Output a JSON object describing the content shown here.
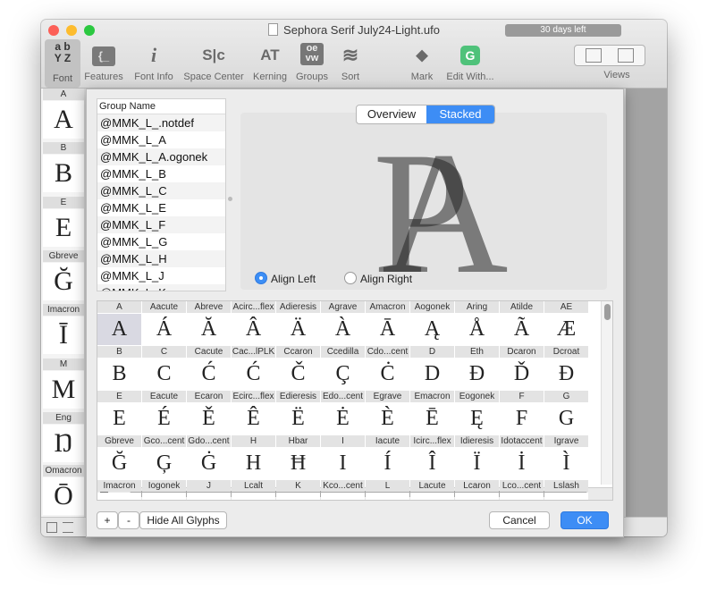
{
  "window": {
    "title": "Sephora Serif July24-Light.ufo",
    "trial_badge": "30 days left"
  },
  "toolbar": {
    "font_glyph": "a b\nY Z",
    "items": [
      {
        "label": "Font",
        "icon": "font-abyz-icon"
      },
      {
        "label": "Features",
        "icon": "features-icon",
        "glyph": "{_"
      },
      {
        "label": "Font Info",
        "icon": "font-info-icon",
        "glyph": "i"
      },
      {
        "label": "Space Center",
        "icon": "space-center-icon",
        "glyph": "S|c"
      },
      {
        "label": "Kerning",
        "icon": "kerning-icon",
        "glyph": "AT"
      },
      {
        "label": "Groups",
        "icon": "groups-icon",
        "glyph": "oe"
      },
      {
        "label": "Sort",
        "icon": "sort-icon",
        "glyph": "≋"
      },
      {
        "label": "Mark",
        "icon": "mark-icon",
        "glyph": "◆"
      },
      {
        "label": "Edit With...",
        "icon": "edit-with-icon",
        "glyph": "G"
      },
      {
        "label": "Views",
        "icon": "views-icon"
      }
    ]
  },
  "background_font": {
    "cells": [
      {
        "name": "A",
        "glyph": "A"
      },
      {
        "name": "B",
        "glyph": "B"
      },
      {
        "name": "E",
        "glyph": "E"
      },
      {
        "name": "Gbreve",
        "glyph": "Ğ"
      },
      {
        "name": "Imacron",
        "glyph": "Ī"
      },
      {
        "name": "M",
        "glyph": "M"
      },
      {
        "name": "Eng",
        "glyph": "Ŋ"
      },
      {
        "name": "Omacron",
        "glyph": "Ō"
      }
    ]
  },
  "groups": {
    "header": "Group Name",
    "items": [
      "@MMK_L_.notdef",
      "@MMK_L_A",
      "@MMK_L_A.ogonek",
      "@MMK_L_B",
      "@MMK_L_C",
      "@MMK_L_E",
      "@MMK_L_F",
      "@MMK_L_G",
      "@MMK_L_H",
      "@MMK_L_J",
      "@MMK_L_K"
    ]
  },
  "preview": {
    "tabs": [
      "Overview",
      "Stacked"
    ],
    "active_tab": "Stacked",
    "align_left": "Align Left",
    "align_right": "Align Right",
    "selected_align": "Align Left"
  },
  "glyph_grid": {
    "rows": [
      [
        [
          "A",
          "A"
        ],
        [
          "Aacute",
          "Á"
        ],
        [
          "Abreve",
          "Ă"
        ],
        [
          "Acirc...flex",
          "Â"
        ],
        [
          "Adieresis",
          "Ä"
        ],
        [
          "Agrave",
          "À"
        ],
        [
          "Amacron",
          "Ā"
        ],
        [
          "Aogonek",
          "Ą"
        ],
        [
          "Aring",
          "Å"
        ],
        [
          "Atilde",
          "Ã"
        ],
        [
          "AE",
          "Æ"
        ]
      ],
      [
        [
          "B",
          "B"
        ],
        [
          "C",
          "C"
        ],
        [
          "Cacute",
          "Ć"
        ],
        [
          "Cac...lPLK",
          "Ć"
        ],
        [
          "Ccaron",
          "Č"
        ],
        [
          "Ccedilla",
          "Ç"
        ],
        [
          "Cdo...cent",
          "Ċ"
        ],
        [
          "D",
          "D"
        ],
        [
          "Eth",
          "Ð"
        ],
        [
          "Dcaron",
          "Ď"
        ],
        [
          "Dcroat",
          "Đ"
        ]
      ],
      [
        [
          "E",
          "E"
        ],
        [
          "Eacute",
          "É"
        ],
        [
          "Ecaron",
          "Ě"
        ],
        [
          "Ecirc...flex",
          "Ê"
        ],
        [
          "Edieresis",
          "Ë"
        ],
        [
          "Edo...cent",
          "Ė"
        ],
        [
          "Egrave",
          "È"
        ],
        [
          "Emacron",
          "Ē"
        ],
        [
          "Eogonek",
          "Ę"
        ],
        [
          "F",
          "F"
        ],
        [
          "G",
          "G"
        ]
      ],
      [
        [
          "Gbreve",
          "Ğ"
        ],
        [
          "Gco...cent",
          "Ģ"
        ],
        [
          "Gdo...cent",
          "Ġ"
        ],
        [
          "H",
          "H"
        ],
        [
          "Hbar",
          "Ħ"
        ],
        [
          "I",
          "I"
        ],
        [
          "Iacute",
          "Í"
        ],
        [
          "Icirc...flex",
          "Î"
        ],
        [
          "Idieresis",
          "Ï"
        ],
        [
          "Idotaccent",
          "İ"
        ],
        [
          "Igrave",
          "Ì"
        ]
      ],
      [
        [
          "Imacron",
          ""
        ],
        [
          "Iogonek",
          ""
        ],
        [
          "J",
          ""
        ],
        [
          "Lcalt",
          ""
        ],
        [
          "K",
          ""
        ],
        [
          "Kco...cent",
          ""
        ],
        [
          "L",
          ""
        ],
        [
          "Lacute",
          ""
        ],
        [
          "Lcaron",
          ""
        ],
        [
          "Lco...cent",
          ""
        ],
        [
          "Lslash",
          ""
        ]
      ]
    ]
  },
  "buttons": {
    "add": "+",
    "remove": "-",
    "hide_all": "Hide All Glyphs",
    "cancel": "Cancel",
    "ok": "OK"
  },
  "colors": {
    "accent": "#3d8df5",
    "close": "#fc5f57",
    "minimize": "#fdbc2e",
    "zoom": "#2bc840"
  }
}
